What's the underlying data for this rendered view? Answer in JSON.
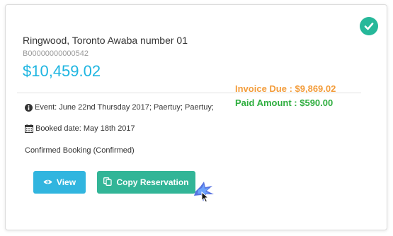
{
  "booking": {
    "title": "Ringwood, Toronto Awaba number 01",
    "booking_id": "B00000000000542",
    "total": "$10,459.02",
    "invoice_due": "Invoice Due : $9,869.02",
    "paid_amount": "Paid Amount : $590.00",
    "event": "Event: June 22nd Thursday 2017; Paertuy; Paertuy;",
    "booked_date": "Booked date: May 18th 2017",
    "status": "Confirmed Booking (Confirmed)"
  },
  "actions": {
    "view_label": "View",
    "copy_label": "Copy Reservation"
  },
  "icons": {
    "status": "check-circle-icon",
    "event": "info-circle-icon",
    "booked": "calendar-icon",
    "view": "eye-icon",
    "copy": "copy-icon",
    "cursor": "mouse-pointer-icon"
  },
  "colors": {
    "total": "#1eb5e1",
    "invoice_due": "#f39c3a",
    "paid_amount": "#2fae3f",
    "view_button": "#31b5df",
    "copy_button": "#32b597",
    "check_badge": "#26b89a"
  }
}
